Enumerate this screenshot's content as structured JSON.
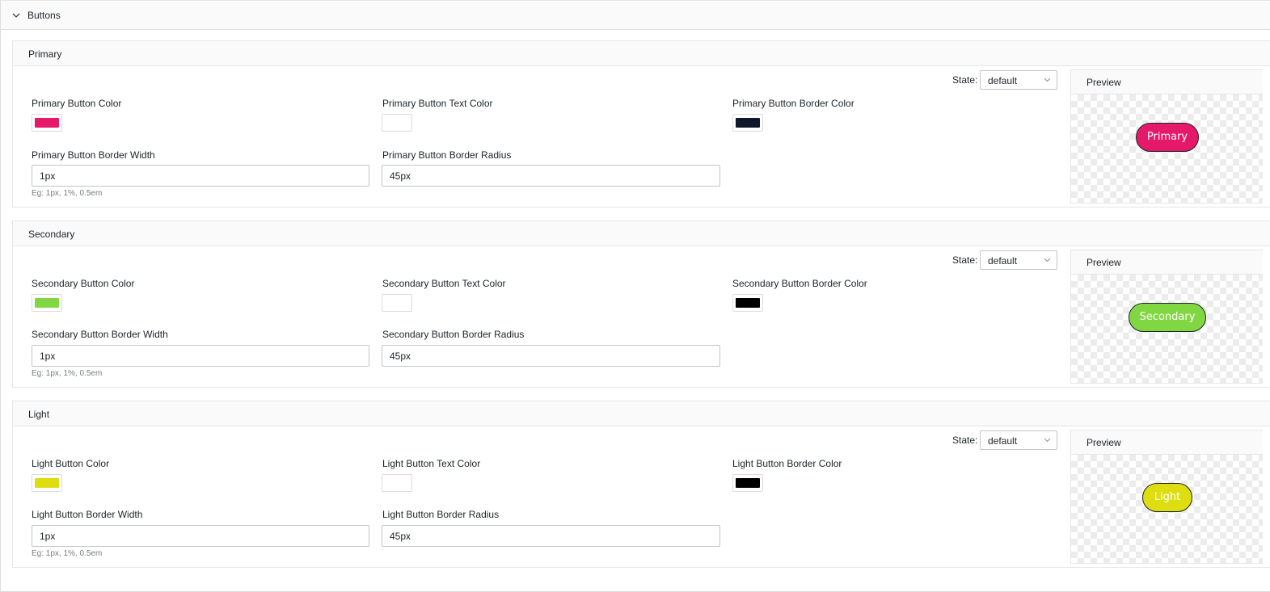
{
  "header": {
    "title": "Buttons",
    "toggle_icon": "chevron-down-icon"
  },
  "sections": [
    {
      "title": "Primary",
      "state_label": "State:",
      "state_value": "default",
      "fields": {
        "color_label": "Primary Button Color",
        "color_value": "#e5186a",
        "text_color_label": "Primary Button Text Color",
        "text_color_value": "#ffffff",
        "border_color_label": "Primary Button Border Color",
        "border_color_value": "#0f172a",
        "border_width_label": "Primary Button Border Width",
        "border_width_value": "1px",
        "border_width_hint": "Eg: 1px, 1%, 0.5em",
        "border_radius_label": "Primary Button Border Radius",
        "border_radius_value": "45px"
      },
      "preview": {
        "title": "Preview",
        "button_label": "Primary"
      }
    },
    {
      "title": "Secondary",
      "state_label": "State:",
      "state_value": "default",
      "fields": {
        "color_label": "Secondary Button Color",
        "color_value": "#81d742",
        "text_color_label": "Secondary Button Text Color",
        "text_color_value": "#ffffff",
        "border_color_label": "Secondary Button Border Color",
        "border_color_value": "#000000",
        "border_width_label": "Secondary Button Border Width",
        "border_width_value": "1px",
        "border_width_hint": "Eg: 1px, 1%, 0.5em",
        "border_radius_label": "Secondary Button Border Radius",
        "border_radius_value": "45px"
      },
      "preview": {
        "title": "Preview",
        "button_label": "Secondary"
      }
    },
    {
      "title": "Light",
      "state_label": "State:",
      "state_value": "default",
      "fields": {
        "color_label": "Light Button Color",
        "color_value": "#dddd0f",
        "text_color_label": "Light Button Text Color",
        "text_color_value": "#ffffff",
        "border_color_label": "Light Button Border Color",
        "border_color_value": "#000000",
        "border_width_label": "Light Button Border Width",
        "border_width_value": "1px",
        "border_width_hint": "Eg: 1px, 1%, 0.5em",
        "border_radius_label": "Light Button Border Radius",
        "border_radius_value": "45px"
      },
      "preview": {
        "title": "Preview",
        "button_label": "Light"
      }
    }
  ]
}
